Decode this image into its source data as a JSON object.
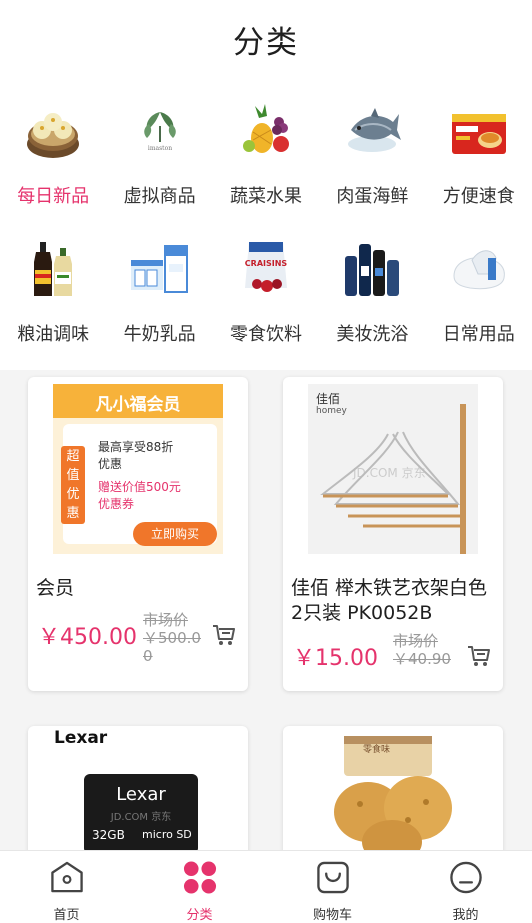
{
  "header": {
    "title": "分类"
  },
  "categories": {
    "row1": [
      {
        "label": "每日新品",
        "icon": "steamed-buns-icon",
        "active": true
      },
      {
        "label": "虚拟商品",
        "icon": "virtual-goods-icon"
      },
      {
        "label": "蔬菜水果",
        "icon": "fruit-vegetable-icon"
      },
      {
        "label": "肉蛋海鲜",
        "icon": "seafood-icon"
      },
      {
        "label": "方便速食",
        "icon": "instant-noodles-icon"
      }
    ],
    "row2": [
      {
        "label": "粮油调味",
        "icon": "sauce-bottles-icon"
      },
      {
        "label": "牛奶乳品",
        "icon": "milk-cartons-icon"
      },
      {
        "label": "零食饮料",
        "icon": "snack-bag-icon"
      },
      {
        "label": "美妆洗浴",
        "icon": "cosmetics-icon"
      },
      {
        "label": "日常用品",
        "icon": "pillow-icon"
      }
    ]
  },
  "products": [
    {
      "name": "会员",
      "price": "￥450.00",
      "market_label": "市场价",
      "market_price": "￥500.00",
      "banner": {
        "title": "凡小福会员",
        "side_tag": "超值优惠",
        "line1": "最高享受88折",
        "line2": "优惠",
        "line3": "赠送价值500元",
        "line4": "优惠券",
        "button": "立即购买"
      }
    },
    {
      "name": "佳佰 榉木铁艺衣架白色 2只装 PK0052B",
      "price": "￥15.00",
      "market_label": "市场价",
      "market_price": "￥40.90",
      "brand": "佳佰",
      "brand_sub": "homey",
      "watermark": "JD.COM 京东"
    },
    {
      "brand": "Lexar",
      "card_brand": "Lexar",
      "card_capacity": "32GB",
      "card_type": "micro SD",
      "watermark": "JD.COM 京东"
    },
    {
      "jar_label": "零食味"
    }
  ],
  "tabbar": [
    {
      "label": "首页",
      "icon": "home-icon"
    },
    {
      "label": "分类",
      "icon": "category-icon",
      "active": true
    },
    {
      "label": "购物车",
      "icon": "cart-icon"
    },
    {
      "label": "我的",
      "icon": "profile-icon"
    }
  ],
  "colors": {
    "accent": "#e5336c",
    "background": "#f4f4f4"
  }
}
